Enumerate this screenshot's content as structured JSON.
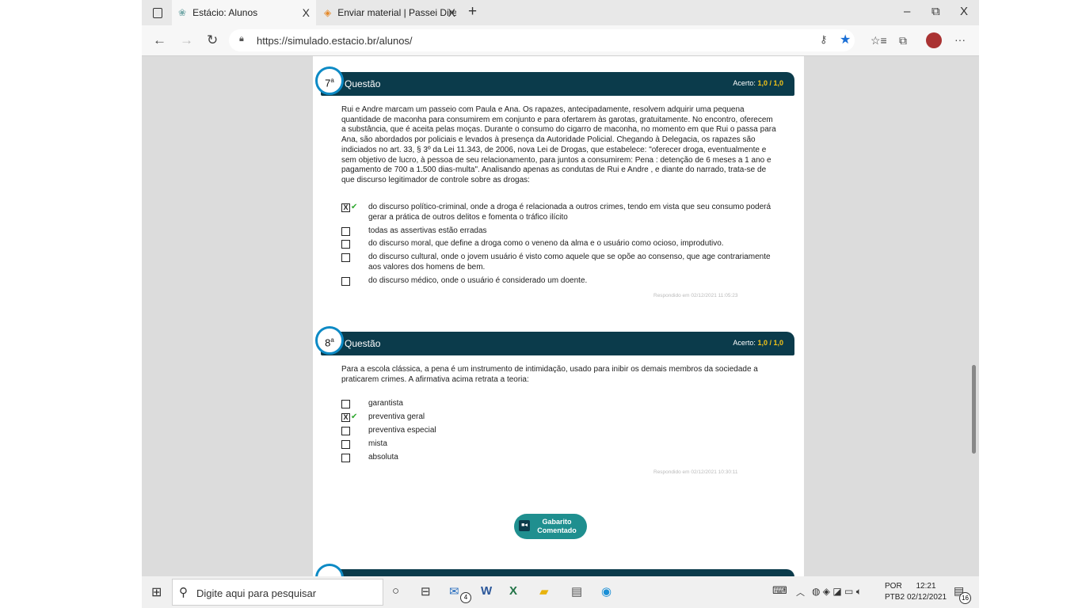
{
  "browser": {
    "tabs": [
      {
        "label": "Estácio: Alunos",
        "close": "X",
        "icon": "estacio-icon"
      },
      {
        "label": "Enviar material | Passei Direto | P",
        "close": "X",
        "icon": "passei-direto-icon"
      }
    ],
    "new_tab": "+",
    "window_controls": {
      "minimize": "–",
      "restore": "⧉",
      "close": "X"
    },
    "url": "https://simulado.estacio.br/alunos/"
  },
  "questions": [
    {
      "number": "7",
      "sup": "a",
      "title": "Questão",
      "score_label": "Acerto:",
      "score_value": "1,0",
      "score_total": "/ 1,0",
      "text": "Rui e Andre marcam um passeio com Paula e Ana. Os rapazes, antecipadamente, resolvem adquirir uma pequena quantidade de maconha para consumirem em conjunto e para ofertarem às garotas, gratuitamente. No encontro, oferecem a substância, que é aceita pelas moças. Durante o consumo do cigarro de maconha, no momento em que Rui o passa para Ana, são abordados por policiais e levados à presença da Autoridade Policial. Chegando à Delegacia, os rapazes são indiciados no art. 33, § 3º da Lei 11.343, de 2006, nova Lei de Drogas, que estabelece: \"oferecer droga, eventualmente e sem objetivo de lucro, à pessoa de seu relacionamento, para juntos a consumirem: Pena : detenção de 6 meses a 1 ano e pagamento de 700 a 1.500 dias-multa\". Analisando apenas as condutas de Rui e Andre , e diante do narrado, trata-se de que discurso legitimador de controle sobre as drogas:",
      "options": [
        {
          "text": "do discurso político-criminal, onde a droga é relacionada a outros crimes, tendo em vista que seu consumo poderá gerar a prática de outros delitos e fomenta o tráfico ilícito",
          "mark": "X",
          "correct": "✔"
        },
        {
          "text": "todas as assertivas estão erradas",
          "mark": "",
          "correct": ""
        },
        {
          "text": "do discurso moral, que define a droga como o veneno da alma e o usuário como ocioso, improdutivo.",
          "mark": "",
          "correct": ""
        },
        {
          "text": "do discurso cultural, onde o jovem usuário é visto como aquele que se opõe ao consenso, que age contrariamente aos valores dos homens de bem.",
          "mark": "",
          "correct": ""
        },
        {
          "text": "do discurso médico, onde o usuário é considerado um doente.",
          "mark": "",
          "correct": ""
        }
      ],
      "answered": "Respondido em 02/12/2021 11:05:23"
    },
    {
      "number": "8",
      "sup": "a",
      "title": "Questão",
      "score_label": "Acerto:",
      "score_value": "1,0",
      "score_total": "/ 1,0",
      "text": "Para a escola clássica, a pena é um instrumento de intimidação, usado para inibir os demais membros da sociedade a praticarem crimes. A afirmativa acima retrata a teoria:",
      "options": [
        {
          "text": "garantista",
          "mark": "",
          "correct": ""
        },
        {
          "text": "preventiva geral",
          "mark": "X",
          "correct": "✔"
        },
        {
          "text": "preventiva especial",
          "mark": "",
          "correct": ""
        },
        {
          "text": "mista",
          "mark": "",
          "correct": ""
        },
        {
          "text": "absoluta",
          "mark": "",
          "correct": ""
        }
      ],
      "answered": "Respondido em 02/12/2021 10:30:11"
    }
  ],
  "gabarito": {
    "line1": "Gabarito",
    "line2": "Comentado",
    "icon": "video-camera-icon"
  },
  "taskbar": {
    "search_placeholder": "Digite aqui para pesquisar",
    "mail_badge": "4",
    "lang1": "POR",
    "lang2": "PTB2",
    "time": "12:21",
    "date": "02/12/2021",
    "notif_count": "16"
  }
}
